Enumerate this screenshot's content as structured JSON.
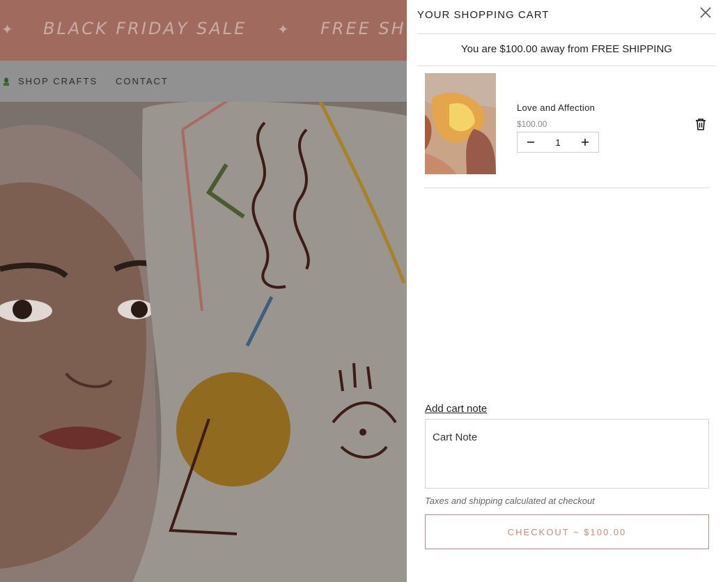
{
  "announcement": {
    "messages": [
      "BLACK FRIDAY SALE",
      "FREE SH"
    ],
    "star_glyph": "✦",
    "background": "#a06a5e"
  },
  "nav": {
    "items": [
      {
        "label": "SHOP CRAFTS",
        "icon": "plant-icon"
      },
      {
        "label": "CONTACT"
      }
    ]
  },
  "cart": {
    "title": "YOUR SHOPPING CART",
    "free_shipping_message": "You are $100.00 away from FREE SHIPPING",
    "items": [
      {
        "name": "Love and Affection",
        "price": "$100.00",
        "quantity": "1"
      }
    ],
    "add_note_label": "Add cart note",
    "note_placeholder": "Cart Note",
    "tax_note": "Taxes and shipping calculated at checkout",
    "checkout_label": "CHECKOUT ~ $100.00",
    "accent_color": "#c98a78"
  },
  "icons": {
    "close": "close-icon",
    "trash": "trash-icon",
    "minus": "minus-icon",
    "plus": "plus-icon"
  }
}
